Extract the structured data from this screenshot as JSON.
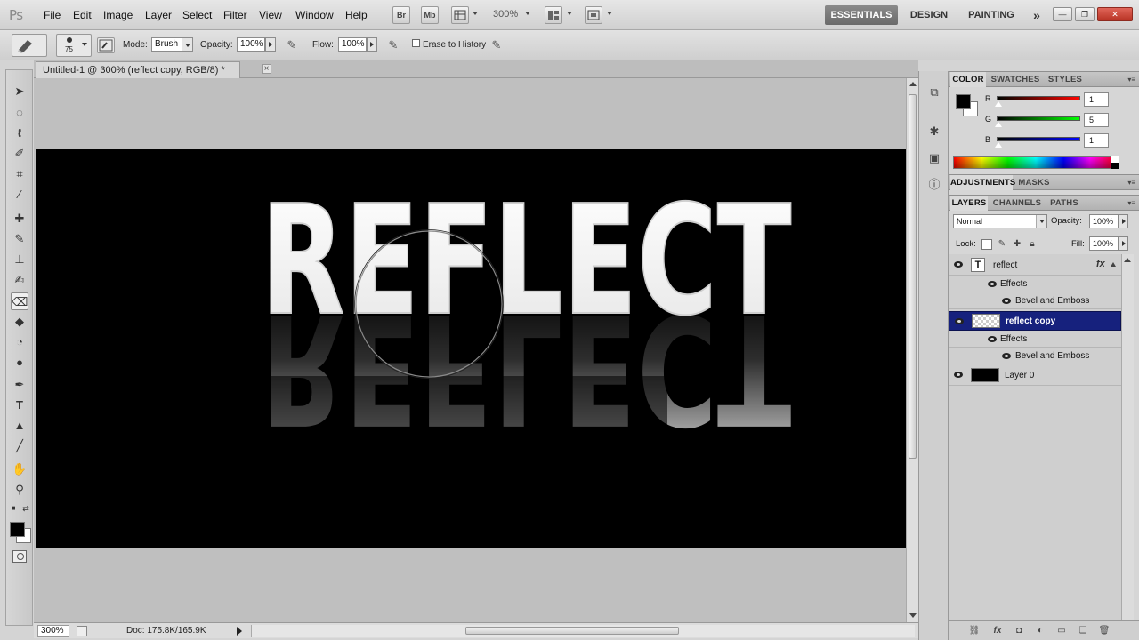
{
  "app": {
    "logo": "Ps",
    "menu": [
      "File",
      "Edit",
      "Image",
      "Layer",
      "Select",
      "Filter",
      "View",
      "Window",
      "Help"
    ],
    "bridge_btn": "Br",
    "minibridge_btn": "Mb",
    "zoom": "300%",
    "workspaces": [
      "ESSENTIALS",
      "DESIGN",
      "PAINTING"
    ],
    "workspace_more": "»",
    "active_workspace": "ESSENTIALS"
  },
  "options": {
    "brush_size": "75",
    "mode_label": "Mode:",
    "mode_value": "Brush",
    "opacity_label": "Opacity:",
    "opacity_value": "100%",
    "flow_label": "Flow:",
    "flow_value": "100%",
    "erase_history_label": "Erase to History"
  },
  "document": {
    "tab_title": "Untitled-1 @ 300% (reflect copy, RGB/8) *",
    "close_glyph": "×",
    "canvas_text": "REFLECT",
    "canvas_bg": "#000000",
    "zoom": "300%",
    "doc_info": "Doc: 175.8K/165.9K"
  },
  "color_panel": {
    "tabs": [
      "COLOR",
      "SWATCHES",
      "STYLES"
    ],
    "active_tab": "COLOR",
    "channels": [
      {
        "label": "R",
        "value": "1"
      },
      {
        "label": "G",
        "value": "5"
      },
      {
        "label": "B",
        "value": "1"
      }
    ]
  },
  "adjustments_panel": {
    "tabs": [
      "ADJUSTMENTS",
      "MASKS"
    ],
    "active_tab": "ADJUSTMENTS"
  },
  "layers_panel": {
    "tabs": [
      "LAYERS",
      "CHANNELS",
      "PATHS"
    ],
    "active_tab": "LAYERS",
    "blend_mode": "Normal",
    "opacity_label": "Opacity:",
    "opacity_value": "100%",
    "lock_label": "Lock:",
    "fill_label": "Fill:",
    "fill_value": "100%",
    "layers": [
      {
        "name": "reflect",
        "type": "text",
        "fx": "fx",
        "effects_label": "Effects",
        "effect": "Bevel and Emboss"
      },
      {
        "name": "reflect copy",
        "type": "transparent",
        "selected": true,
        "effects_label": "Effects",
        "effect": "Bevel and Emboss"
      },
      {
        "name": "Layer 0",
        "type": "fill-black"
      }
    ]
  },
  "colors": {
    "selection": "#16217d",
    "foreground": "#000000",
    "background": "#ffffff"
  }
}
